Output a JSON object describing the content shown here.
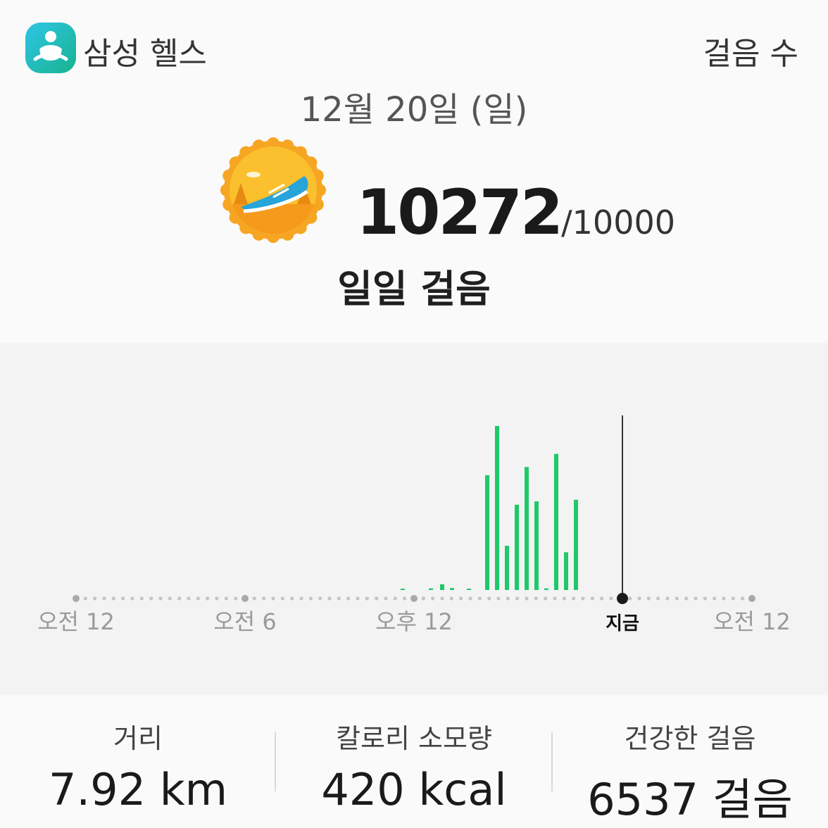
{
  "header": {
    "app_name": "삼성 헬스",
    "page_label": "걸음 수"
  },
  "date": "12월 20일 (일)",
  "summary": {
    "steps": "10272",
    "goal": "/10000",
    "label": "일일 걸음"
  },
  "colors": {
    "bar": "#1ec96a",
    "now_line": "#333333",
    "badge_orange": "#f6a623",
    "badge_gold": "#fbc02d"
  },
  "icons": {
    "app": "samsung-health-runner-icon",
    "badge": "sneaker-badge-icon"
  },
  "chart_data": {
    "type": "bar",
    "x_tick_labels": [
      "오전 12",
      "오전 6",
      "오후 12",
      "지금",
      "오전 12"
    ],
    "now_label": "지금",
    "now_hour": 19.4,
    "ylim": [
      0,
      1
    ],
    "bars": [
      {
        "hour": 11.6,
        "value": 0.005
      },
      {
        "hour": 12.6,
        "value": 0.01
      },
      {
        "hour": 13.0,
        "value": 0.035
      },
      {
        "hour": 13.35,
        "value": 0.012
      },
      {
        "hour": 13.95,
        "value": 0.008
      },
      {
        "hour": 14.6,
        "value": 0.7
      },
      {
        "hour": 14.95,
        "value": 1.0
      },
      {
        "hour": 15.3,
        "value": 0.27
      },
      {
        "hour": 15.65,
        "value": 0.52
      },
      {
        "hour": 16.0,
        "value": 0.75
      },
      {
        "hour": 16.35,
        "value": 0.54
      },
      {
        "hour": 16.7,
        "value": 0.01
      },
      {
        "hour": 17.05,
        "value": 0.83
      },
      {
        "hour": 17.4,
        "value": 0.23
      },
      {
        "hour": 17.75,
        "value": 0.55
      }
    ]
  },
  "stats": [
    {
      "label": "거리",
      "value": "7.92 km"
    },
    {
      "label": "칼로리 소모량",
      "value": "420 kcal"
    },
    {
      "label": "건강한 걸음",
      "value": "6537 걸음"
    }
  ]
}
